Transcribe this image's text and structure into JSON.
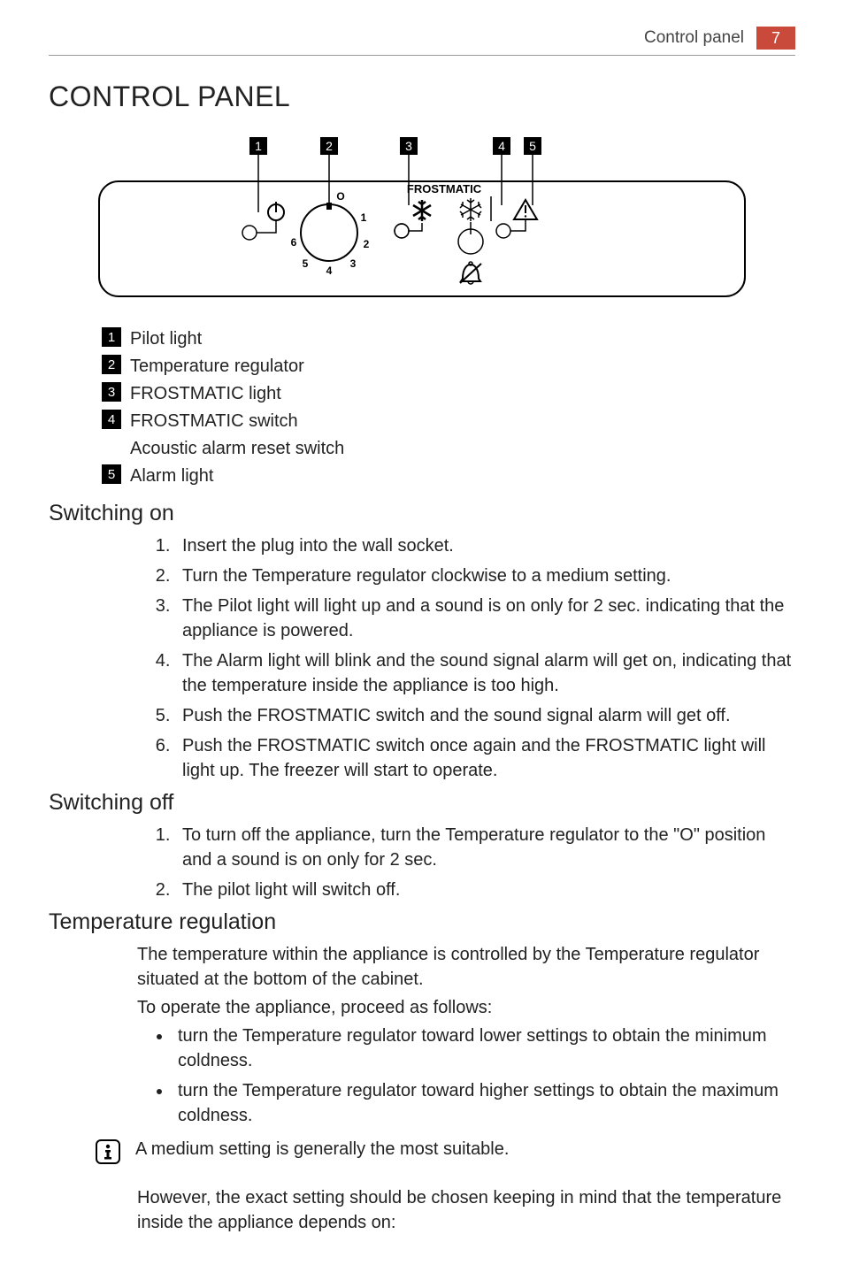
{
  "header": {
    "section": "Control panel",
    "page_number": "7"
  },
  "title": "CONTROL PANEL",
  "diagram": {
    "callouts": [
      "1",
      "2",
      "3",
      "4",
      "5"
    ],
    "frostmatic_label": "FROSTMATIC",
    "dial_positions": [
      "O",
      "1",
      "2",
      "3",
      "4",
      "5",
      "6"
    ]
  },
  "legend": [
    {
      "num": "1",
      "text": "Pilot light"
    },
    {
      "num": "2",
      "text": "Temperature regulator"
    },
    {
      "num": "3",
      "text": "FROSTMATIC light"
    },
    {
      "num": "4",
      "text": "FROSTMATIC switch",
      "sub": "Acoustic alarm reset switch"
    },
    {
      "num": "5",
      "text": "Alarm light"
    }
  ],
  "sections": {
    "switching_on": {
      "heading": "Switching on",
      "steps": [
        "Insert the plug into the wall socket.",
        "Turn the Temperature regulator clockwise to a medium setting.",
        "The Pilot light will light up and a sound is on only for 2 sec. indicating that the appliance is powered.",
        "The Alarm light will blink and the sound signal alarm will get on, indicating that the temperature inside the appliance is too high.",
        "Push the FROSTMATIC switch and the sound signal alarm will get off.",
        "Push the FROSTMATIC switch once again and the FROSTMATIC light will light up. The freezer will start to operate."
      ]
    },
    "switching_off": {
      "heading": "Switching off",
      "steps": [
        "To turn off the appliance, turn the Temperature regulator to the \"O\" position and a sound is on only for 2 sec.",
        "The pilot light will switch off."
      ]
    },
    "temp_reg": {
      "heading": "Temperature regulation",
      "para1": "The temperature within the appliance is controlled by the Temperature regulator situated at the bottom of the cabinet.",
      "para2": "To operate the appliance, proceed as follows:",
      "bullets": [
        "turn the Temperature regulator toward lower settings to obtain the minimum coldness.",
        "turn the Temperature regulator toward higher settings to obtain the maximum coldness."
      ],
      "info": "A medium setting is generally the most suitable.",
      "para3": "However, the exact setting should be chosen keeping in mind that the temperature inside the appliance depends on:"
    }
  }
}
